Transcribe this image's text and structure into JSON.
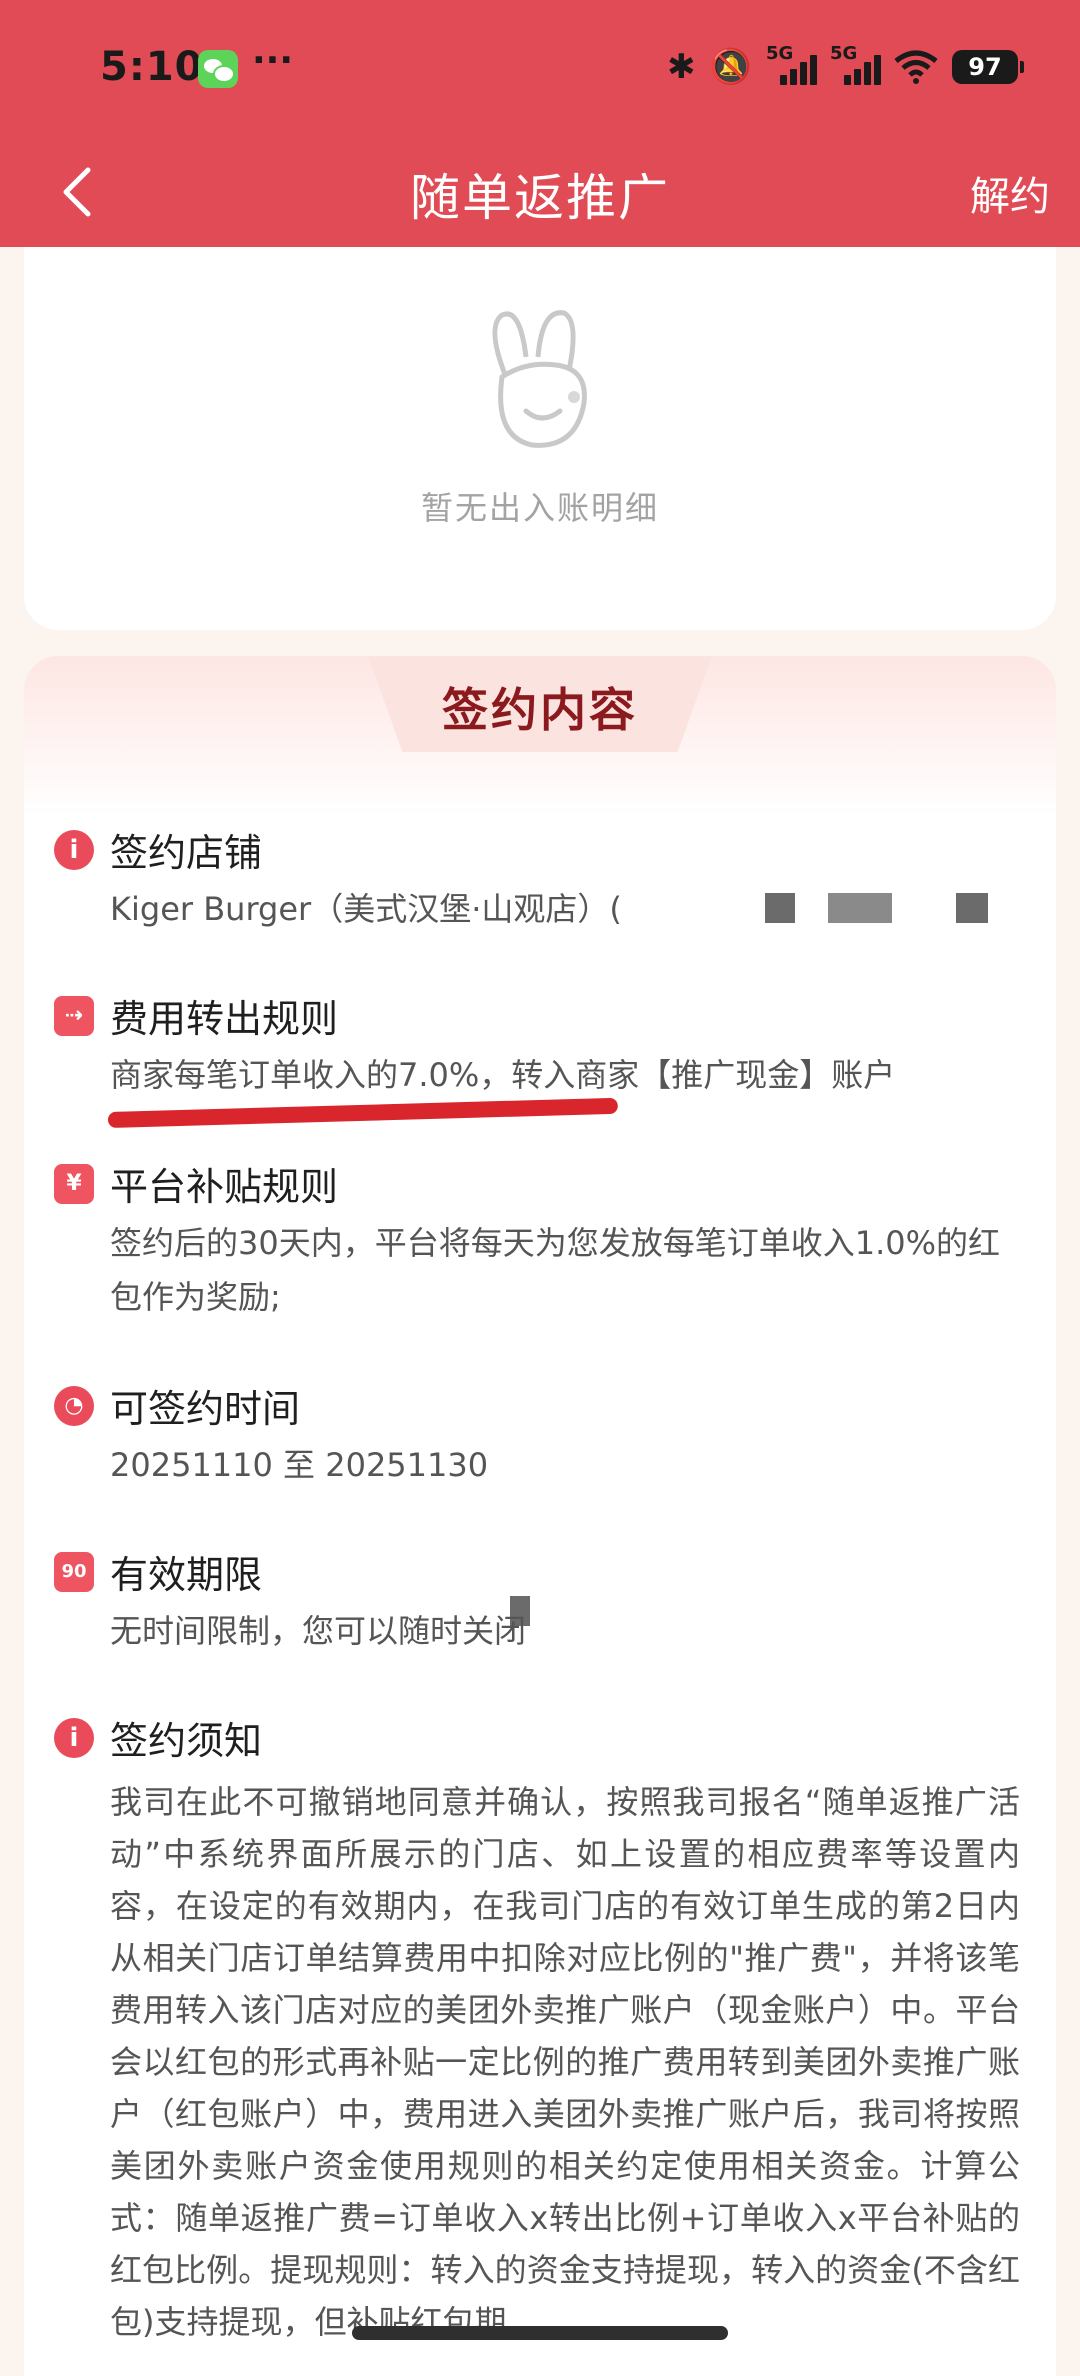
{
  "status_bar": {
    "time": "5:10",
    "battery": "97",
    "net1": "5G",
    "net2": "5G"
  },
  "nav": {
    "title": "随单返推广",
    "cancel_label": "解约"
  },
  "empty_state": {
    "text": "暂无出入账明细"
  },
  "section": {
    "title": "签约内容"
  },
  "items": [
    {
      "icon": "info-icon",
      "heading": "签约店铺",
      "text": "Kiger Burger（美式汉堡·山观店）("
    },
    {
      "icon": "transfer-icon",
      "heading": "费用转出规则",
      "text": "商家每笔订单收入的7.0%，转入商家【推广现金】账户"
    },
    {
      "icon": "yen-icon",
      "heading": "平台补贴规则",
      "text": "签约后的30天内，平台将每天为您发放每笔订单收入1.0%的红包作为奖励;"
    },
    {
      "icon": "clock-icon",
      "heading": "可签约时间",
      "text": "20251110 至 20251130"
    },
    {
      "icon": "calendar-90-icon",
      "icon_text": "90",
      "heading": "有效期限",
      "text": "无时间限制，您可以随时关闭"
    },
    {
      "icon": "info-icon",
      "heading": "签约须知",
      "text": "我司在此不可撤销地同意并确认，按照我司报名“随单返推广活动”中系统界面所展示的门店、如上设置的相应费率等设置内容，在设定的有效期内，在我司门店的有效订单生成的第2日内从相关门店订单结算费用中扣除对应比例的\"推广费\"，并将该笔费用转入该门店对应的美团外卖推广账户（现金账户）中。平台会以红包的形式再补贴一定比例的推广费用转到美团外卖推广账户（红包账户）中，费用进入美团外卖推广账户后，我司将按照美团外卖账户资金使用规则的相关约定使用相关资金。计算公式：随单返推广费=订单收入x转出比例+订单收入x平台补贴的红包比例。提现规则：转入的资金支持提现，转入的资金(不含红包)支持提现，但补贴红包期"
    }
  ],
  "colors": {
    "header": "#e04b55",
    "accent": "#e94b5a",
    "section_title": "#8b1a1f",
    "annotation": "#d9262c"
  }
}
